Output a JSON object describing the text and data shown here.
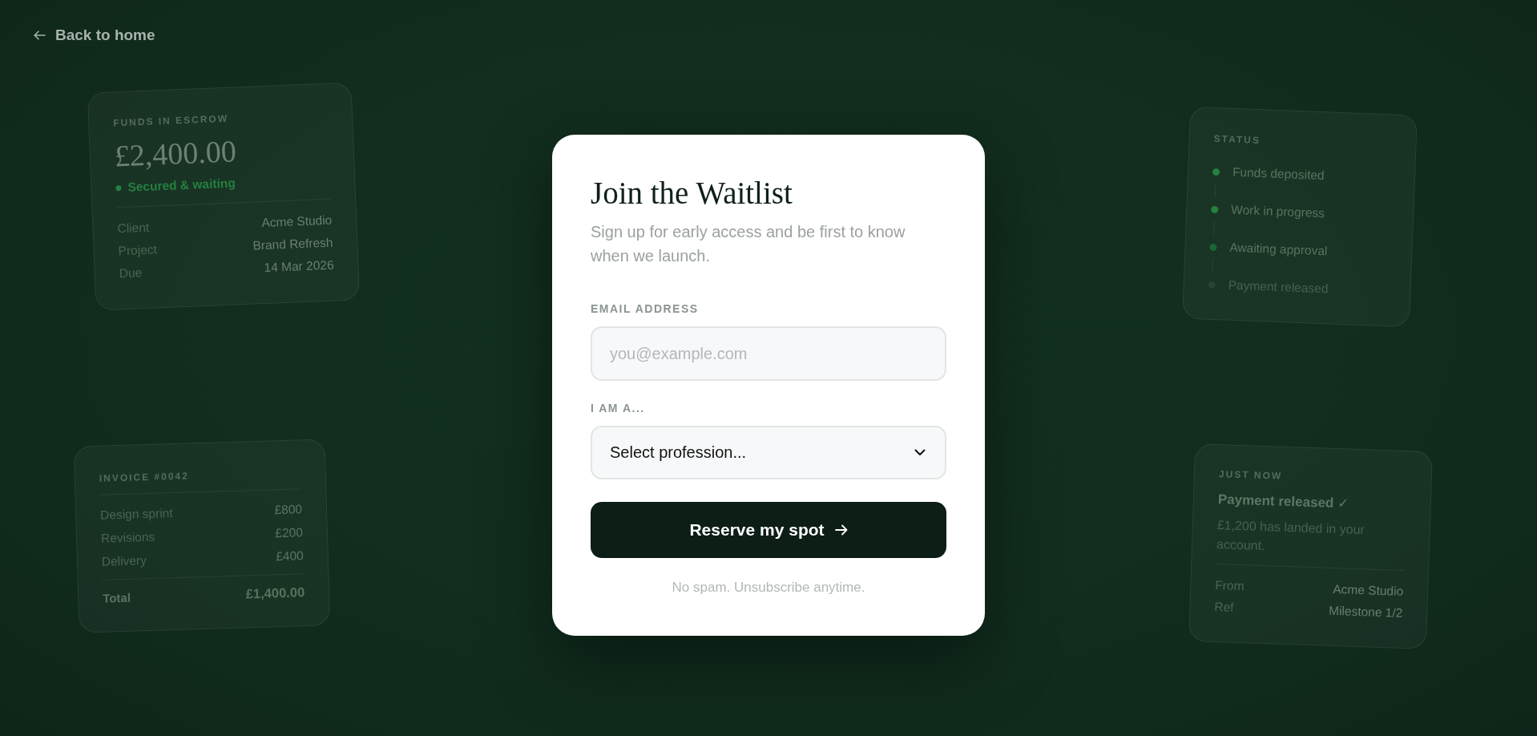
{
  "back_link": {
    "label": "Back to home"
  },
  "cards": [
    {
      "kind": "escrow",
      "title": "FUNDS IN ESCROW",
      "amount": "£2,400.00",
      "status": "Secured & waiting",
      "details": [
        {
          "label": "Client",
          "value": "Acme Studio"
        },
        {
          "label": "Project",
          "value": "Brand Refresh"
        },
        {
          "label": "Due",
          "value": "14 Mar 2026"
        }
      ]
    },
    {
      "kind": "invoice",
      "title": "INVOICE #0042",
      "lines": [
        {
          "label": "Design sprint",
          "value": "£800"
        },
        {
          "label": "Revisions",
          "value": "£200"
        },
        {
          "label": "Delivery",
          "value": "£400"
        }
      ],
      "total": {
        "label": "Total",
        "value": "£1,400.00"
      }
    },
    {
      "kind": "status",
      "title": "STATUS",
      "steps": [
        {
          "label": "Funds deposited",
          "done": true,
          "color": "#24823f"
        },
        {
          "label": "Work in progress",
          "done": true,
          "color": "#24823f"
        },
        {
          "label": "Awaiting approval",
          "done": true,
          "color": "#1c6534"
        },
        {
          "label": "Payment released",
          "done": false,
          "color": "#2a4235"
        }
      ]
    },
    {
      "kind": "notification",
      "title": "JUST NOW",
      "heading": "Payment released ✓",
      "message": "£1,200 has landed in your account.",
      "details": [
        {
          "label": "From",
          "value": "Acme Studio"
        },
        {
          "label": "Ref",
          "value": "Milestone 1/2"
        }
      ]
    }
  ],
  "form": {
    "title": "Join the Waitlist",
    "subtitle": "Sign up for early access and be first to know when we launch.",
    "email": {
      "label": "EMAIL ADDRESS",
      "placeholder": "you@example.com"
    },
    "profession": {
      "label": "I AM A...",
      "value": "Select profession..."
    },
    "submit": {
      "label": "Reserve my spot"
    },
    "note": "No spam. Unsubscribe anytime."
  }
}
